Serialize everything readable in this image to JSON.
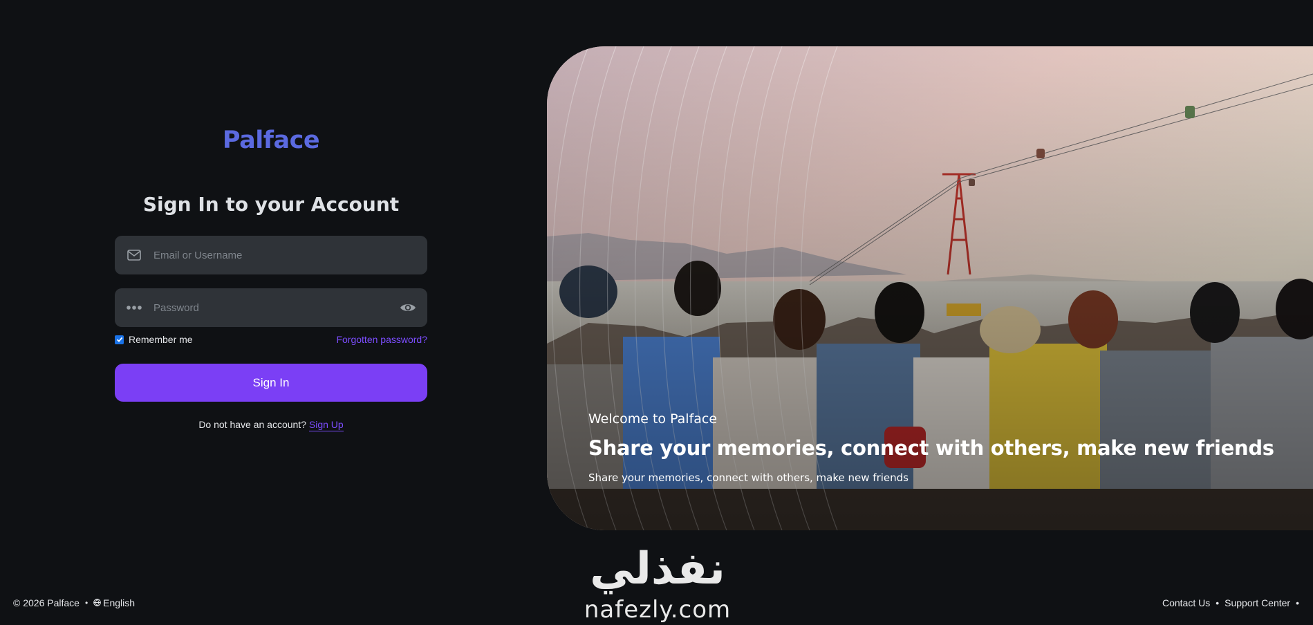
{
  "brand": {
    "name": "Palface"
  },
  "login": {
    "heading": "Sign In to your Account",
    "email_placeholder": "Email or Username",
    "password_placeholder": "Password",
    "remember_label": "Remember me",
    "remember_checked": true,
    "forgot_label": "Forgotten password?",
    "signin_label": "Sign In",
    "no_account_text": "Do not have an account?",
    "signup_label": "Sign Up"
  },
  "hero": {
    "welcome": "Welcome to Palface",
    "tagline": "Share your memories, connect with others, make new friends",
    "subtagline": "Share your memories, connect with others, make new friends"
  },
  "watermark": {
    "arabic": "نفذلي",
    "latin": "nafezly.com"
  },
  "footer": {
    "copyright": "© 2026 Palface",
    "language": "English",
    "links": [
      "Contact Us",
      "Support Center"
    ]
  },
  "colors": {
    "background": "#0f1114",
    "brand": "#5b6ae0",
    "accent": "#7b3ff5",
    "link": "#7c4dff",
    "field": "#2f3338"
  },
  "icons": {
    "email": "envelope-icon",
    "password": "dots-icon",
    "toggle": "eye-icon",
    "language": "globe-icon"
  }
}
